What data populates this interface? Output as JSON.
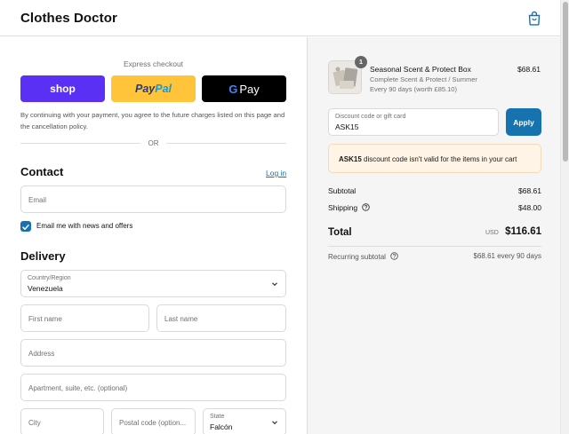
{
  "header": {
    "brand": "Clothes Doctor",
    "cart_icon": "shopping-bag-icon"
  },
  "express": {
    "title": "Express checkout",
    "shop_label": "shop",
    "paypal_label_1": "Pay",
    "paypal_label_2": "Pal",
    "gpay_g": "G",
    "gpay_label": "Pay",
    "consent": "By continuing with your payment, you agree to the future charges listed on this page and the cancellation policy.",
    "or": "OR",
    "colors": {
      "shop": "#5a31f4",
      "paypal": "#ffc439",
      "gpay": "#000000"
    }
  },
  "contact": {
    "title": "Contact",
    "login": "Log in",
    "email_placeholder": "Email",
    "news_label": "Email me with news and offers",
    "news_checked": true
  },
  "delivery": {
    "title": "Delivery",
    "country_label": "Country/Region",
    "country_value": "Venezuela",
    "first_name_placeholder": "First name",
    "last_name_placeholder": "Last name",
    "address_placeholder": "Address",
    "apartment_placeholder": "Apartment, suite, etc. (optional)",
    "city_placeholder": "City",
    "postal_placeholder": "Postal code (option...",
    "state_label": "State",
    "state_value": "Falcón"
  },
  "summary": {
    "item": {
      "quantity": "1",
      "name": "Seasonal Scent & Protect Box",
      "variant": "Complete Scent & Protect / Summer",
      "plan": "Every 90 days (worth £85.10)",
      "price": "$68.61"
    },
    "discount": {
      "label": "Discount code or gift card",
      "value": "ASK15",
      "apply": "Apply"
    },
    "alert": {
      "code": "ASK15",
      "message": "discount code isn't valid for the items in your cart"
    },
    "subtotal_label": "Subtotal",
    "subtotal": "$68.61",
    "shipping_label": "Shipping",
    "shipping": "$48.00",
    "total_label": "Total",
    "currency": "USD",
    "total": "$116.61",
    "recurring_label": "Recurring subtotal",
    "recurring": "$68.61 every 90 days",
    "accent": "#1773b0"
  }
}
